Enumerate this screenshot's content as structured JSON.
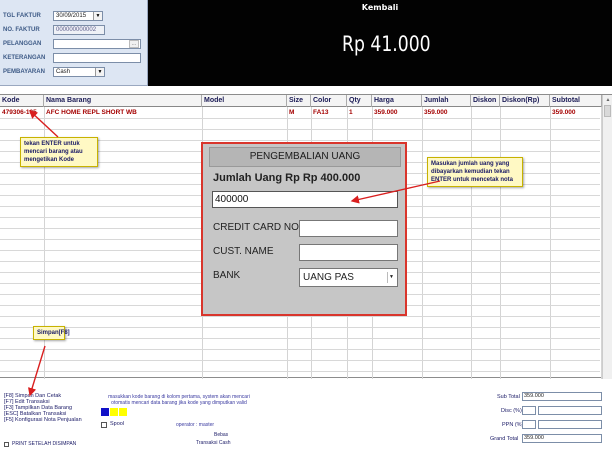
{
  "form": {
    "tgl_faktur_label": "TGL FAKTUR",
    "tgl_faktur_value": "30/09/2015",
    "no_faktur_label": "NO. FAKTUR",
    "no_faktur_value": "000000000002",
    "pelanggan_label": "PELANGGAN",
    "pelanggan_value": "",
    "pelanggan_button": "...",
    "keterangan_label": "KETERANGAN",
    "keterangan_value": "",
    "pembayaran_label": "PEMBAYARAN",
    "pembayaran_value": "Cash"
  },
  "kembali": {
    "title": "Kembali",
    "amount": "Rp 41.000"
  },
  "grid": {
    "columns": [
      "Kode",
      "Nama Barang",
      "Model",
      "Size",
      "Color",
      "Qty",
      "Harga",
      "Jumlah",
      "Diskon",
      "Diskon(Rp)",
      "Subtotal"
    ],
    "rows": [
      {
        "kode": "479306-105",
        "nama_barang": "AFC HOME  REPL SHORT WB",
        "model": "",
        "size": "M",
        "color": "FA13",
        "qty": "1",
        "harga": "359.000",
        "jumlah": "359.000",
        "diskon": "",
        "diskon_rp": "",
        "subtotal": "359.000"
      }
    ]
  },
  "notes": {
    "enter_note": "tekan ENTER untuk mencari barang atau mengetikan Kode",
    "amount_note": "Masukan jumlah uang yang dibayarkan kemudian tekan ENTER untuk mencetak nota",
    "simpan_note": "Simpan[F8]"
  },
  "dialog": {
    "title": "PENGEMBALIAN UANG",
    "jumlah_uang": "Jumlah Uang Rp Rp 400.000",
    "amount_value": "400000",
    "credit_card_label": "CREDIT CARD NO.",
    "cust_name_label": "CUST. NAME",
    "bank_label": "BANK",
    "bank_value": "UANG PAS"
  },
  "footer": {
    "shortcuts": [
      "[F8] Simpan Dan Cetak",
      "[F7] Edit Transaksi",
      "[F3] Tampilkan Data Barang",
      "[ESC] Batalkan Transaksi",
      "[F5] Konfigurasi Nota Penjualan"
    ],
    "hint": "masukkan kode barang di kolom pertama, system akan mencari otomatis mencari data barang jika kode yang dimputkan valid",
    "spool_label": "Spool",
    "operator": "operator : master",
    "bebas": "Bebas",
    "transaksi": "Transaksi Cash",
    "print_label": "PRINT SETELAH DISIMPAN",
    "colors": {
      "blue": "#1010c8",
      "yellow": "#ffff00"
    },
    "totals": {
      "sub_total_label": "Sub Total",
      "sub_total_value": "359.000",
      "disc_label": "Disc (%)",
      "disc_value": "",
      "ppn_label": "PPN (%)",
      "ppn_value": "",
      "grand_total_label": "Grand Total",
      "grand_total_value": "359.000"
    }
  },
  "colors": {
    "header_bg": "#020202",
    "dialog_border": "#d9352c",
    "dialog_bg": "#c6c6c6",
    "row_text": "#a40000",
    "note_bg": "#fff9c4"
  }
}
